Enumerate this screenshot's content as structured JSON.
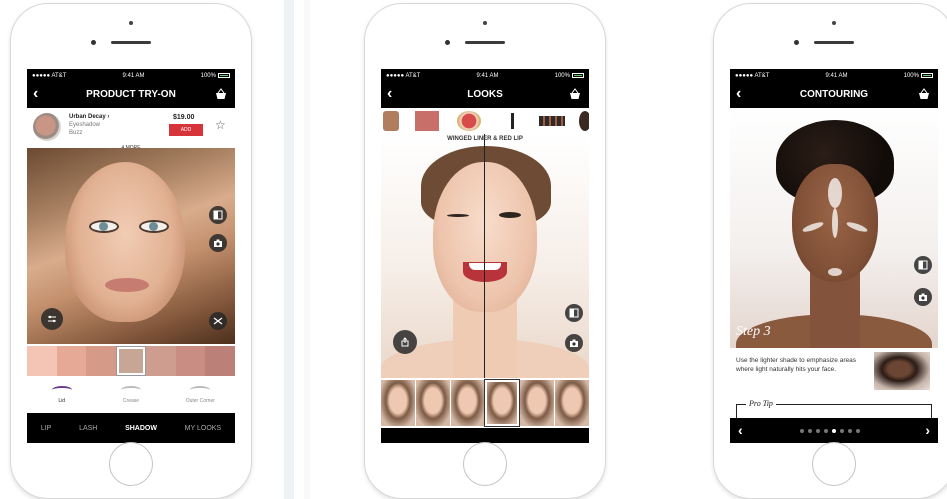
{
  "phones": [
    {
      "status": {
        "carrier": "●●●●● AT&T",
        "time": "9:41 AM",
        "battery": "100%"
      },
      "nav": {
        "back": "‹",
        "title": "PRODUCT TRY-ON"
      },
      "product": {
        "brand": "Urban Decay",
        "brand_suffix": "›",
        "type": "Eyeshadow",
        "shade": "Buzz",
        "price": "$19.00",
        "add": "ADD",
        "more": "4 MORE"
      },
      "swatch_colors": [
        "#f4c5b5",
        "#e6a995",
        "#d59b88",
        "#c8a696",
        "#cf9d8f",
        "#c98d83",
        "#bb8077"
      ],
      "selected_swatch": 3,
      "subtabs": [
        {
          "label": "Lid"
        },
        {
          "label": "Crease"
        },
        {
          "label": "Outer Corner"
        }
      ],
      "tabs": [
        "LIP",
        "LASH",
        "SHADOW",
        "MY LOOKS"
      ],
      "active_tab": "SHADOW"
    },
    {
      "status": {
        "carrier": "●●●●● AT&T",
        "time": "9:41 AM",
        "battery": "100%"
      },
      "nav": {
        "back": "‹",
        "title": "LOOKS"
      },
      "look_label": "WINGED LINER & RED LIP",
      "thumb_count": 6,
      "selected_thumb": 3
    },
    {
      "status": {
        "carrier": "●●●●● AT&T",
        "time": "9:41 AM",
        "battery": "100%"
      },
      "nav": {
        "back": "‹",
        "title": "CONTOURING"
      },
      "step_label": "Step 3",
      "instruction": "Use the lighter shade to emphasize areas where light naturally hits your face.",
      "pro_tip": "Pro Tip",
      "pager": {
        "prev": "‹",
        "next": "›",
        "dot_count": 8,
        "active_dot": 4
      }
    }
  ],
  "colors": {
    "sephora_red": "#d7333b",
    "active_purple": "#6a3b8a"
  }
}
